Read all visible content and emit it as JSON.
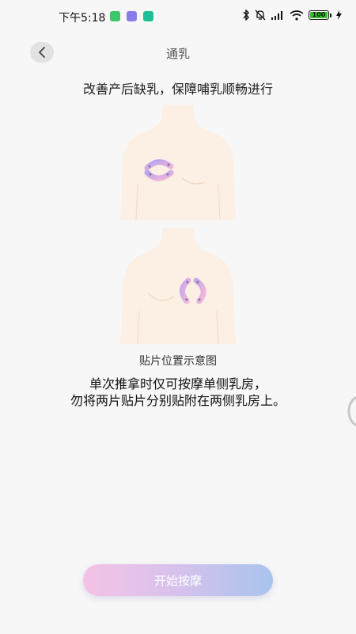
{
  "status_bar": {
    "time": "下午5:18",
    "battery": "100",
    "icons": [
      "app-notification-icon",
      "app-notification-icon",
      "app-notification-icon",
      "bluetooth-icon",
      "mute-icon",
      "signal-icon",
      "wifi-icon",
      "battery-icon",
      "charging-icon"
    ]
  },
  "header": {
    "title": "通乳"
  },
  "subtitle": "改善产后缺乳，保障哺乳顺畅进行",
  "caption": "贴片位置示意图",
  "instructions": {
    "line1": "单次推拿时仅可按摩单侧乳房，",
    "line2": "勿将两片贴片分别贴附在两侧乳房上。"
  },
  "start_button": {
    "label": "开始按摩"
  },
  "colors": {
    "body_fill": "#fcefe4",
    "pad_purple": "#c9a8ec",
    "pad_pink": "#f2b6d8",
    "button_start": "#f4c2e6",
    "button_end": "#a8c4ee"
  }
}
